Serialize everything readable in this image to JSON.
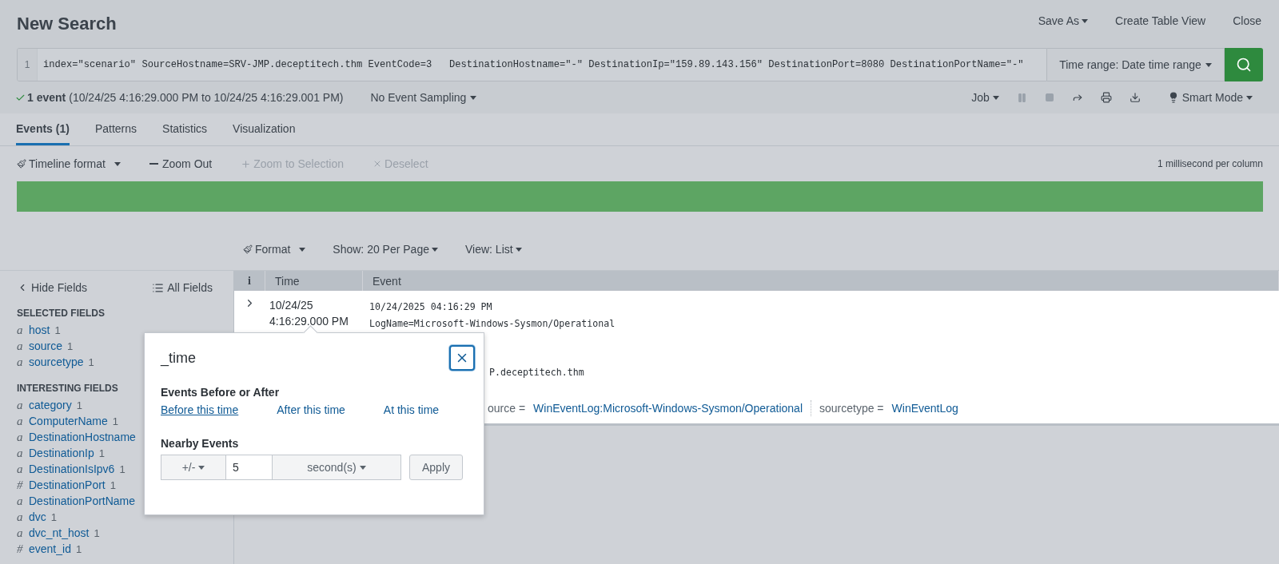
{
  "header": {
    "title": "New Search",
    "actions": [
      {
        "label": "Save As",
        "dropdown": true
      },
      {
        "label": "Create Table View",
        "dropdown": false
      },
      {
        "label": "Close",
        "dropdown": false
      }
    ]
  },
  "search": {
    "line_number": "1",
    "query": "index=\"scenario\" SourceHostname=SRV-JMP.deceptitech.thm EventCode=3   DestinationHostname=\"-\" DestinationIp=\"159.89.143.156\" DestinationPort=8080 DestinationPortName=\"-\"",
    "time_range": "Time range: Date time range"
  },
  "status": {
    "count": "1 event",
    "range": "(10/24/25 4:16:29.000 PM to 10/24/25 4:16:29.001 PM)",
    "sampling": "No Event Sampling",
    "job": "Job",
    "mode": "Smart Mode"
  },
  "job_controls": [
    {
      "kind": "pause",
      "disabled": true
    },
    {
      "kind": "stop",
      "disabled": true
    },
    {
      "kind": "share",
      "disabled": false
    },
    {
      "kind": "print",
      "disabled": false
    },
    {
      "kind": "export",
      "disabled": false
    }
  ],
  "tabs": [
    {
      "label": "Events (1)",
      "selected": true
    },
    {
      "label": "Patterns",
      "selected": false
    },
    {
      "label": "Statistics",
      "selected": false
    },
    {
      "label": "Visualization",
      "selected": false
    }
  ],
  "timeline": {
    "tools": [
      {
        "kind": "format",
        "label": "Timeline format",
        "disabled": false
      },
      {
        "kind": "zoom-out",
        "label": "Zoom Out",
        "disabled": false
      },
      {
        "kind": "zoom-in",
        "label": "Zoom to Selection",
        "disabled": true
      },
      {
        "kind": "deselect",
        "label": "Deselect",
        "disabled": true
      }
    ],
    "scale": "1 millisecond per column"
  },
  "results_toolbar": [
    {
      "kind": "format",
      "label": "Format"
    },
    {
      "kind": "menu",
      "label": "Show: 20 Per Page"
    },
    {
      "kind": "menu",
      "label": "View: List"
    }
  ],
  "sidebar": {
    "hide": "Hide Fields",
    "all": "All Fields",
    "sections": [
      {
        "title": "SELECTED FIELDS",
        "fields": [
          {
            "type": "a",
            "name": "host",
            "count": "1"
          },
          {
            "type": "a",
            "name": "source",
            "count": "1"
          },
          {
            "type": "a",
            "name": "sourcetype",
            "count": "1"
          }
        ]
      },
      {
        "title": "INTERESTING FIELDS",
        "fields": [
          {
            "type": "a",
            "name": "category",
            "count": "1"
          },
          {
            "type": "a",
            "name": "ComputerName",
            "count": "1"
          },
          {
            "type": "a",
            "name": "DestinationHostname"
          },
          {
            "type": "a",
            "name": "DestinationIp",
            "count": "1"
          },
          {
            "type": "a",
            "name": "DestinationIsIpv6",
            "count": "1"
          },
          {
            "type": "#",
            "name": "DestinationPort",
            "count": "1"
          },
          {
            "type": "a",
            "name": "DestinationPortName"
          },
          {
            "type": "a",
            "name": "dvc",
            "count": "1"
          },
          {
            "type": "a",
            "name": "dvc_nt_host",
            "count": "1"
          },
          {
            "type": "#",
            "name": "event_id",
            "count": "1"
          }
        ]
      }
    ]
  },
  "table": {
    "columns": [
      "i",
      "Time",
      "Event"
    ],
    "rows": [
      {
        "expanded": false,
        "time": [
          "10/24/25",
          "4:16:29.000 PM"
        ],
        "lines": [
          "10/24/2025 04:16:29 PM",
          "LogName=Microsoft-Windows-Sysmon/Operational"
        ],
        "partial_lines": [
          "P.deceptitech.thm"
        ],
        "fields": [
          {
            "key": "ource =",
            "value": "WinEventLog:Microsoft-Windows-Sysmon/Operational"
          },
          {
            "key": "sourcetype =",
            "value": "WinEventLog"
          }
        ]
      }
    ]
  },
  "popover": {
    "title": "_time",
    "section": "Events Before or After",
    "links": [
      {
        "label": "Before this time",
        "selected": true
      },
      {
        "label": "After this time",
        "selected": false
      },
      {
        "label": "At this time",
        "selected": false
      }
    ],
    "nearby": {
      "title": "Nearby Events",
      "direction": "+/-",
      "amount": "5",
      "unit": "second(s)",
      "apply": "Apply"
    }
  }
}
